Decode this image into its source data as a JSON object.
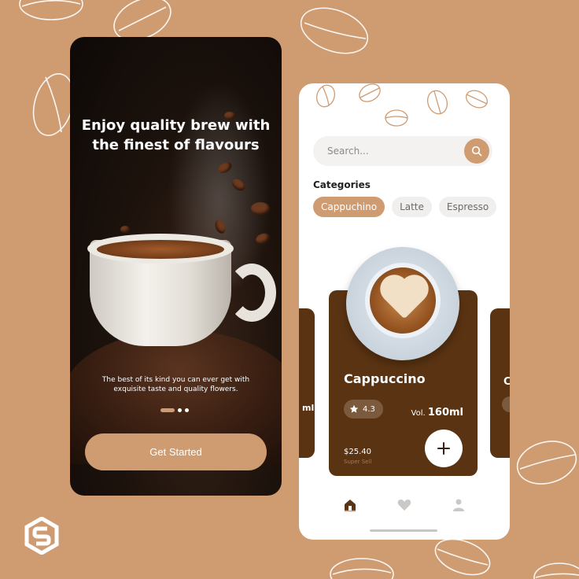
{
  "onboarding": {
    "headline": "Enjoy quality brew with the finest of flavours",
    "description": "The best of its kind you can ever get with exquisite taste and quality flowers.",
    "cta_label": "Get Started",
    "page_dots": 3,
    "active_dot": 0
  },
  "home": {
    "search_placeholder": "Search...",
    "categories_title": "Categories",
    "categories": [
      "Cappuchino",
      "Latte",
      "Espresso"
    ],
    "active_category": "Cappuchino",
    "product": {
      "name": "Cappuccino",
      "rating": "4.3",
      "volume_label": "Vol.",
      "volume_value": "160ml",
      "price": "$25.40",
      "price_note": "Super Sell"
    },
    "side_card_left_partial": "ml",
    "side_card_right_partial": "C",
    "nav": [
      "home-icon",
      "heart-icon",
      "user-icon"
    ],
    "active_nav": "home-icon"
  },
  "colors": {
    "background": "#cf9c72",
    "accent": "#cf9c72",
    "card_brown": "#5a3312",
    "dark_phone": "#1e130d"
  },
  "brand": {
    "logo": "hexagon-s-logo"
  }
}
